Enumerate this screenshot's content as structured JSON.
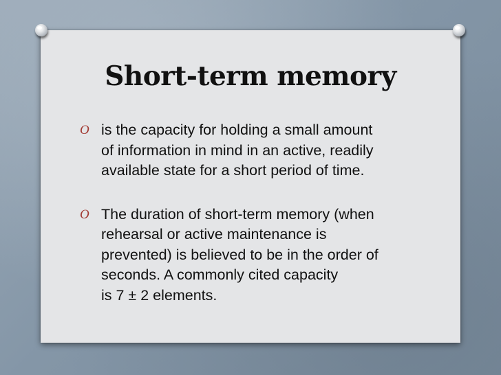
{
  "slide": {
    "title": "Short-term memory",
    "bullet_marker": "O",
    "bullets": [
      {
        "lines": [
          "is the capacity for holding a small amount",
          "of information in mind in an active, readily",
          "available state for a short period of time."
        ]
      },
      {
        "lines": [
          "The duration of short-term memory (when",
          "rehearsal or active maintenance is",
          "prevented) is believed to be in the order of",
          "seconds. A commonly cited capacity",
          "is 7 ± 2 elements."
        ]
      }
    ]
  },
  "colors": {
    "background": "#8a9bab",
    "board": "#e4e5e7",
    "text": "#111111",
    "bullet_marker": "#a23a33"
  },
  "icons": {
    "left_pin": "pushpin-icon",
    "right_pin": "pushpin-icon"
  }
}
